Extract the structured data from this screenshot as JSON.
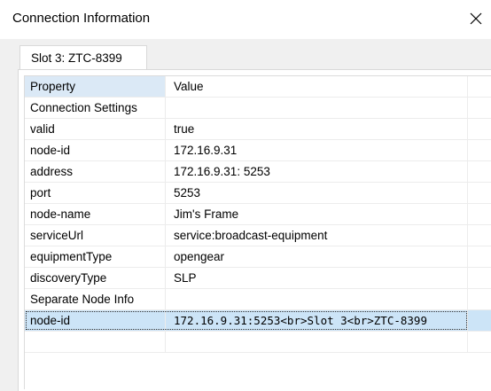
{
  "window": {
    "title": "Connection Information",
    "close_icon": "close-icon"
  },
  "tab": {
    "label": "Slot 3: ZTC-8399"
  },
  "table": {
    "headers": [
      "Property",
      "Value"
    ],
    "rows": [
      {
        "property": "Connection Settings",
        "value": ""
      },
      {
        "property": "valid",
        "value": "true"
      },
      {
        "property": "node-id",
        "value": "172.16.9.31"
      },
      {
        "property": "address",
        "value": "172.16.9.31: 5253"
      },
      {
        "property": "port",
        "value": "5253"
      },
      {
        "property": "node-name",
        "value": "Jim's Frame"
      },
      {
        "property": "serviceUrl",
        "value": "service:broadcast-equipment"
      },
      {
        "property": "equipmentType",
        "value": "opengear"
      },
      {
        "property": "discoveryType",
        "value": "SLP"
      },
      {
        "property": "Separate Node Info",
        "value": ""
      },
      {
        "property": "node-id",
        "value": "172.16.9.31:5253<br>Slot 3<br>ZTC-8399"
      }
    ],
    "selected_row": 10
  },
  "colors": {
    "header_property_bg": "#dbe9f6",
    "selected_row_bg": "#cce4f7",
    "client_bg": "#f0f0f0"
  }
}
